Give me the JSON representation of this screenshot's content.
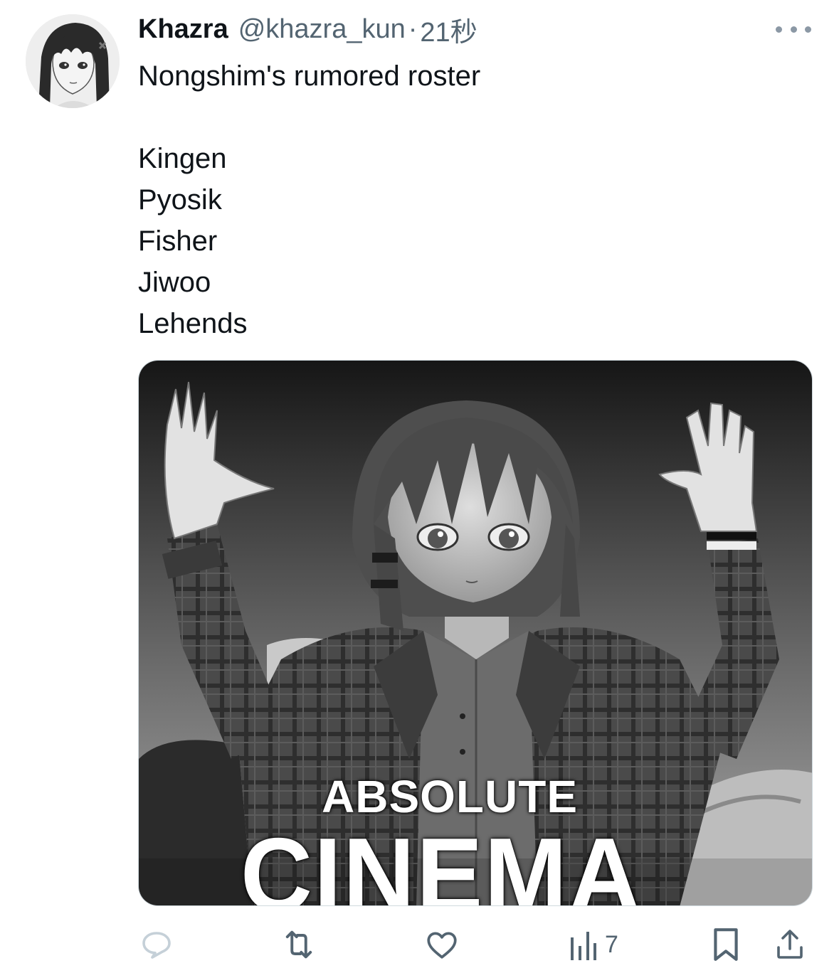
{
  "tweet": {
    "display_name": "Khazra",
    "handle": "@khazra_kun",
    "separator": "·",
    "timestamp": "21秒",
    "text_lines": [
      "Nongshim's rumored roster",
      "",
      "Kingen",
      "Pyosik",
      "Fisher",
      "Jiwoo",
      "Lehends"
    ]
  },
  "media": {
    "caption_top": "ABSOLUTE",
    "caption_bottom": "CINEMA"
  },
  "actions": {
    "reply_icon": "reply-icon",
    "retweet_icon": "retweet-icon",
    "like_icon": "heart-icon",
    "views_icon": "views-icon",
    "views_count": "7",
    "bookmark_icon": "bookmark-icon",
    "share_icon": "share-icon"
  },
  "colors": {
    "text_primary": "#0f1419",
    "text_secondary": "#536471",
    "reply_icon_faded": "#c5d0d8"
  }
}
